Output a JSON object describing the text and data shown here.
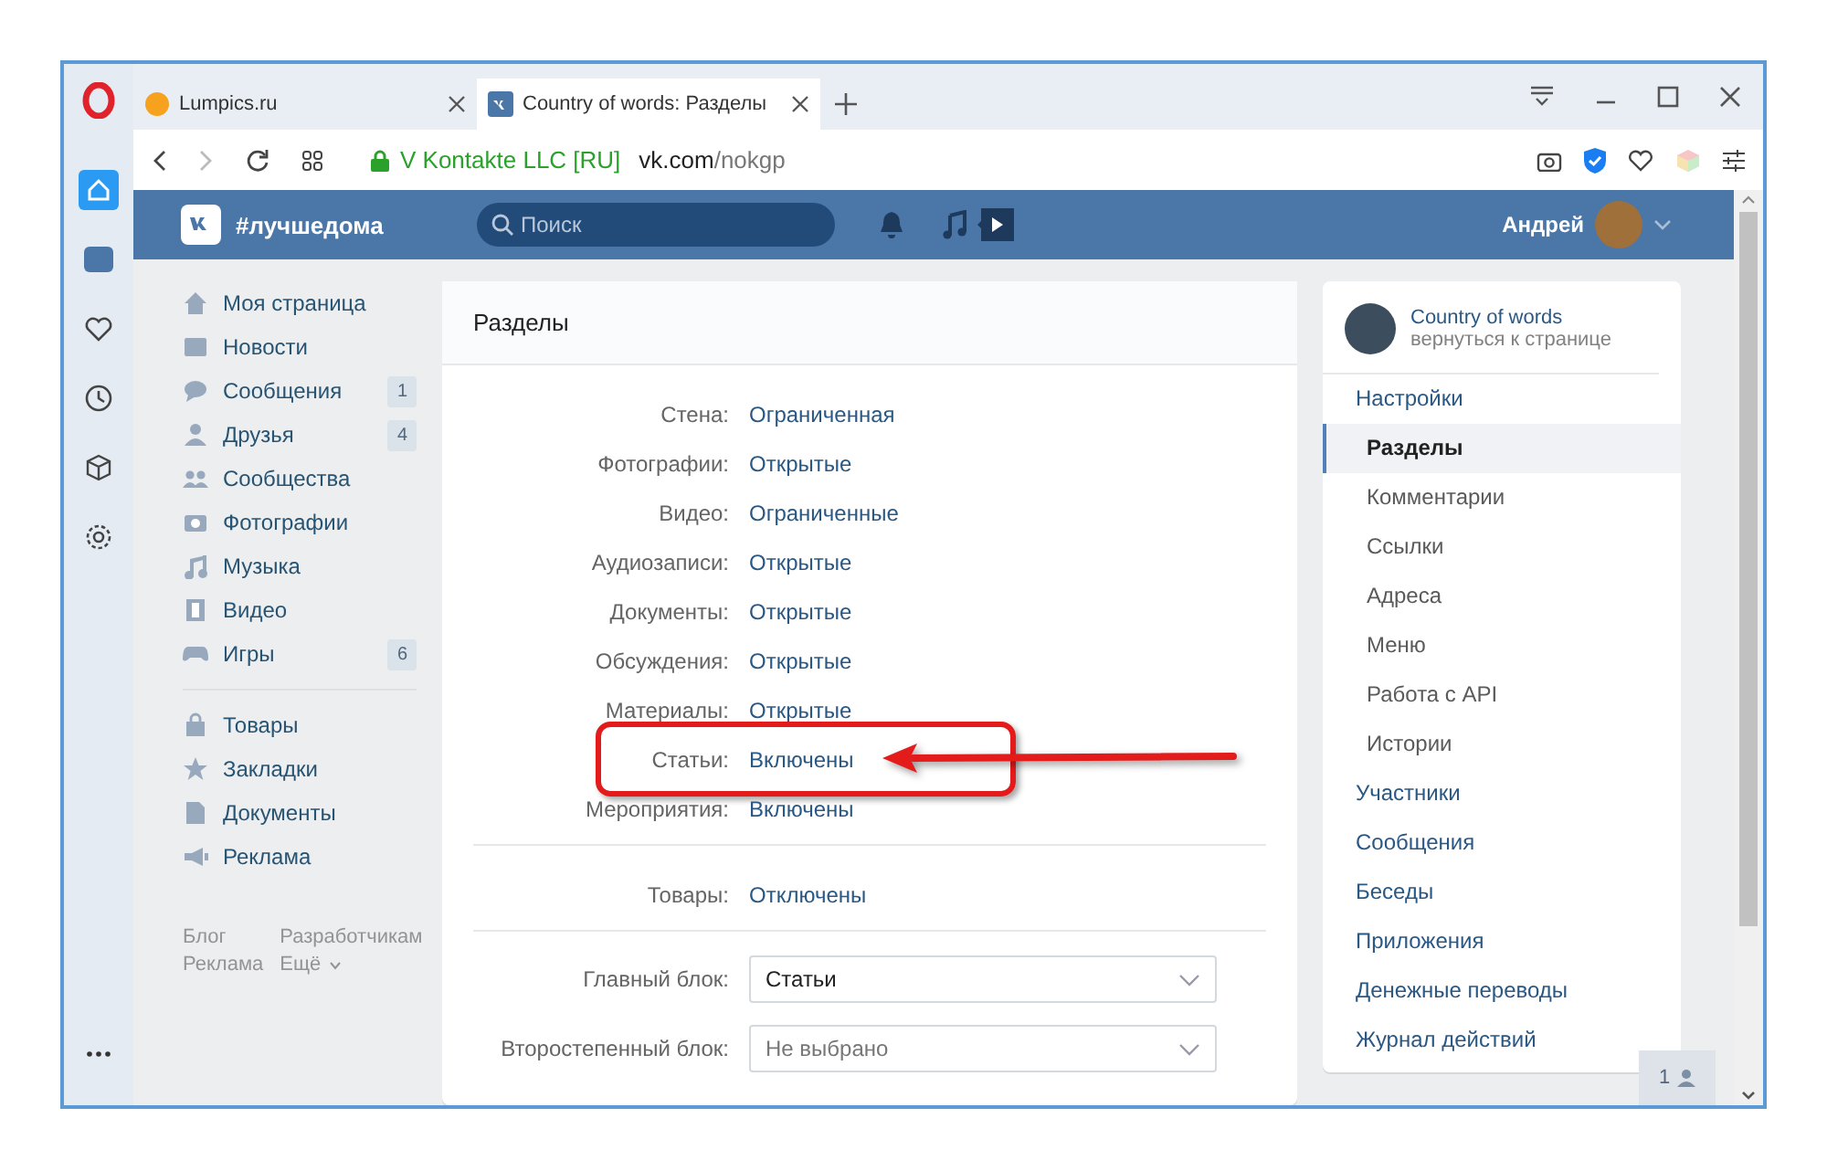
{
  "browser": {
    "tabs": [
      {
        "title": "Lumpics.ru",
        "selected": false
      },
      {
        "title": "Country of words: Разделы",
        "selected": true
      }
    ],
    "address": {
      "site_owner": "V Kontakte LLC [RU]",
      "host": "vk.com",
      "path": "/nokgp"
    },
    "sidebar": [
      {
        "selected": true
      },
      {
        "selected": false
      },
      {
        "selected": false
      },
      {
        "selected": false
      },
      {
        "selected": false
      },
      {
        "selected": false
      }
    ]
  },
  "header": {
    "hashtag": "#лучшедома",
    "search": {
      "placeholder": "Поиск"
    },
    "user": "Андрей"
  },
  "nav": [
    [
      {
        "label": "Моя страница"
      },
      {
        "label": "Новости"
      },
      {
        "label": "Сообщения",
        "count": "1"
      },
      {
        "label": "Друзья",
        "count": "4"
      },
      {
        "label": "Сообщества"
      },
      {
        "label": "Фотографии"
      },
      {
        "label": "Музыка"
      },
      {
        "label": "Видео"
      },
      {
        "label": "Игры",
        "count": "6"
      }
    ],
    [
      {
        "label": "Товары"
      },
      {
        "label": "Закладки"
      },
      {
        "label": "Документы"
      },
      {
        "label": "Реклама"
      }
    ]
  ],
  "footer_links": [
    "Блог",
    "Разработчикам",
    "Реклама",
    "Ещё"
  ],
  "panel": {
    "title": "Разделы",
    "groups": [
      [
        {
          "label": "Стена:",
          "value": "Ограниченная",
          "highlighted": false
        },
        {
          "label": "Фотографии:",
          "value": "Открытые",
          "highlighted": false
        },
        {
          "label": "Видео:",
          "value": "Ограниченные",
          "highlighted": false
        },
        {
          "label": "Аудиозаписи:",
          "value": "Открытые",
          "highlighted": false
        },
        {
          "label": "Документы:",
          "value": "Открытые",
          "highlighted": false
        },
        {
          "label": "Обсуждения:",
          "value": "Открытые",
          "highlighted": false
        },
        {
          "label": "Материалы:",
          "value": "Открытые",
          "highlighted": false
        },
        {
          "label": "Статьи:",
          "value": "Включены",
          "highlighted": true
        },
        {
          "label": "Мероприятия:",
          "value": "Включены",
          "highlighted": false
        }
      ],
      [
        {
          "label": "Товары:",
          "value": "Отключены",
          "highlighted": false
        }
      ]
    ],
    "blocks": [
      {
        "label": "Главный блок:",
        "value": "Статьи"
      },
      {
        "label": "Второстепенный блок:",
        "placeholder": "Не выбрано"
      }
    ]
  },
  "community": {
    "name": "Country of words",
    "back_link": "вернуться к странице"
  },
  "menu": [
    {
      "label": "Настройки",
      "selected": false,
      "children": [
        {
          "label": "Разделы",
          "selected": true
        },
        {
          "label": "Комментарии",
          "selected": false
        },
        {
          "label": "Ссылки",
          "selected": false
        },
        {
          "label": "Адреса",
          "selected": false
        },
        {
          "label": "Меню",
          "selected": false
        },
        {
          "label": "Работа с API",
          "selected": false
        },
        {
          "label": "Истории",
          "selected": false
        }
      ]
    },
    {
      "label": "Участники",
      "selected": false
    },
    {
      "label": "Сообщения",
      "selected": false
    },
    {
      "label": "Беседы",
      "selected": false
    },
    {
      "label": "Приложения",
      "selected": false
    },
    {
      "label": "Денежные переводы",
      "selected": false
    },
    {
      "label": "Журнал действий",
      "selected": false
    }
  ],
  "online_widget": {
    "count": "1"
  }
}
